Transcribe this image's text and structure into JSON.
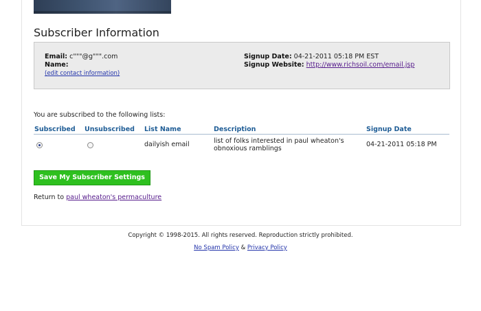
{
  "page": {
    "section_title": "Subscriber Information"
  },
  "subscriber": {
    "email_label": "Email:",
    "email_value": "c\"\"\"@g\"\"\".com",
    "name_label": "Name:",
    "name_value": "",
    "edit_link": "(edit contact information)",
    "signup_date_label": "Signup Date:",
    "signup_date_value": "04-21-2011 05:18 PM EST",
    "signup_website_label": "Signup Website:",
    "signup_website_value": "http://www.richsoil.com/email.jsp"
  },
  "lists": {
    "intro": "You are subscribed to the following lists:",
    "headers": [
      "Subscribed",
      "Unsubscribed",
      "List Name",
      "Description",
      "Signup Date"
    ],
    "rows": [
      {
        "subscribed": true,
        "list_name": "dailyish email",
        "description": "list of folks interested in paul wheaton's obnoxious ramblings",
        "signup_date": "04-21-2011 05:18 PM"
      }
    ]
  },
  "actions": {
    "save_label": "Save My Subscriber Settings",
    "return_prefix": "Return to",
    "return_link": "paul wheaton's permaculture"
  },
  "footer": {
    "copyright": "Copyright © 1998-2015. All rights reserved. Reproduction strictly prohibited.",
    "no_spam": "No Spam Policy",
    "separator": "&",
    "privacy": "Privacy Policy"
  }
}
